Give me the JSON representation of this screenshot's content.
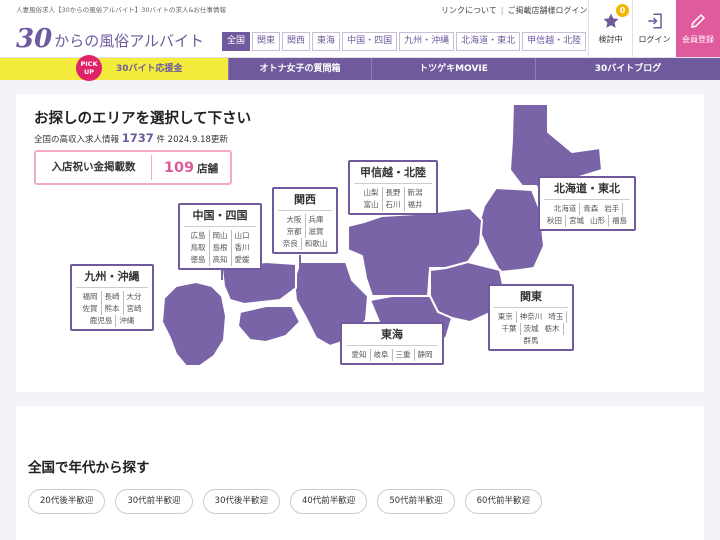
{
  "header": {
    "tagline": "人妻風俗求人【30からの風俗アルバイト】30バイトの求人&お仕事情報",
    "logo_num": "30",
    "logo_rest": "からの風俗アルバイト",
    "links": [
      "リンクについて",
      "ご掲載店舗様ログイン"
    ],
    "area_tabs": [
      "全国",
      "関東",
      "関西",
      "東海",
      "中国・四国",
      "九州・沖縄",
      "北海道・東北",
      "甲信越・北陸"
    ],
    "buttons": {
      "favorites": "検討中",
      "favorites_count": "0",
      "login": "ログイン",
      "register": "会員登録"
    }
  },
  "pnav": {
    "pickup": "PICK UP",
    "items": [
      "30バイト応援金",
      "オトナ女子の質問箱",
      "トツゲキMOVIE",
      "30バイトブログ"
    ]
  },
  "map": {
    "title": "お探しのエリアを選択して下さい",
    "count_prefix": "全国の高収入求人情報",
    "count": "1737",
    "count_unit": "件",
    "updated": "2024.9.18更新",
    "shops_label": "入店祝い金掲載数",
    "shops_count": "109",
    "shops_unit": "店舗",
    "regions": {
      "kyushu": {
        "name": "九州・沖縄",
        "prefs": [
          "福岡",
          "長崎",
          "大分",
          "佐賀",
          "熊本",
          "宮崎",
          "鹿児島",
          "沖縄"
        ]
      },
      "chugoku": {
        "name": "中国・四国",
        "prefs": [
          "広島",
          "岡山",
          "山口",
          "鳥取",
          "島根",
          "香川",
          "徳島",
          "高知",
          "愛媛"
        ]
      },
      "kansai": {
        "name": "関西",
        "prefs": [
          "大阪",
          "兵庫",
          "京都",
          "滋賀",
          "奈良",
          "和歌山"
        ]
      },
      "koshinetsu": {
        "name": "甲信越・北陸",
        "prefs": [
          "山梨",
          "長野",
          "新潟",
          "富山",
          "石川",
          "福井"
        ]
      },
      "tohoku": {
        "name": "北海道・東北",
        "prefs": [
          "北海道",
          "青森",
          "岩手",
          "秋田",
          "宮城",
          "山形",
          "福島"
        ]
      },
      "kanto": {
        "name": "関東",
        "prefs": [
          "東京",
          "神奈川",
          "埼玉",
          "千葉",
          "茨城",
          "栃木",
          "群馬"
        ]
      },
      "tokai": {
        "name": "東海",
        "prefs": [
          "愛知",
          "岐阜",
          "三重",
          "静岡"
        ]
      }
    }
  },
  "age": {
    "title": "全国で年代から探す",
    "buttons": [
      "20代後半歓迎",
      "30代前半歓迎",
      "30代後半歓迎",
      "40代前半歓迎",
      "50代前半歓迎",
      "60代前半歓迎"
    ]
  },
  "colors": {
    "accent": "#6e5a9c",
    "pink": "#e05a9e",
    "yellow": "#f4ec3c",
    "map_fill": "#7a64a8"
  }
}
